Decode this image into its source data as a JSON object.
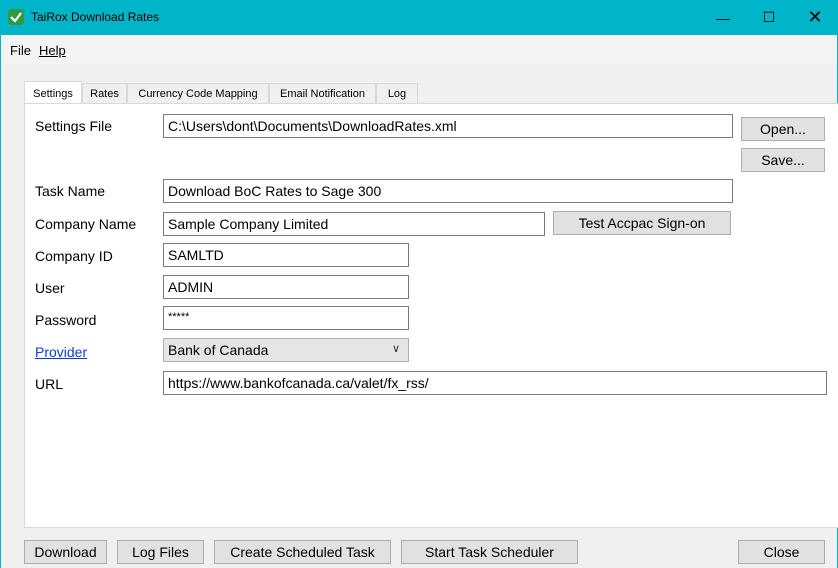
{
  "window": {
    "title": "TaiRox Download Rates"
  },
  "menu": {
    "file": "File",
    "help": "Help"
  },
  "tabs": [
    "Settings",
    "Rates",
    "Currency Code Mapping",
    "Email Notification",
    "Log"
  ],
  "form": {
    "settings_file": {
      "label": "Settings File",
      "value": "C:\\Users\\dont\\Documents\\DownloadRates.xml"
    },
    "task_name": {
      "label": "Task Name",
      "value": "Download BoC Rates to Sage 300"
    },
    "company_name": {
      "label": "Company Name",
      "value": "Sample Company Limited"
    },
    "company_id": {
      "label": "Company ID",
      "value": "SAMLTD"
    },
    "user": {
      "label": "User",
      "value": "ADMIN"
    },
    "password": {
      "label": "Password",
      "value": "*****"
    },
    "provider": {
      "label": "Provider",
      "value": "Bank of Canada"
    },
    "url": {
      "label": "URL",
      "value": "https://www.bankofcanada.ca/valet/fx_rss/"
    }
  },
  "buttons": {
    "open": "Open...",
    "save": "Save...",
    "test_signon": "Test Accpac Sign-on",
    "download": "Download",
    "log_files": "Log Files",
    "create_task": "Create Scheduled Task",
    "start_scheduler": "Start Task Scheduler",
    "close": "Close"
  },
  "colors": {
    "titlebar": "#00b4c8",
    "link": "#0a3cd4"
  }
}
